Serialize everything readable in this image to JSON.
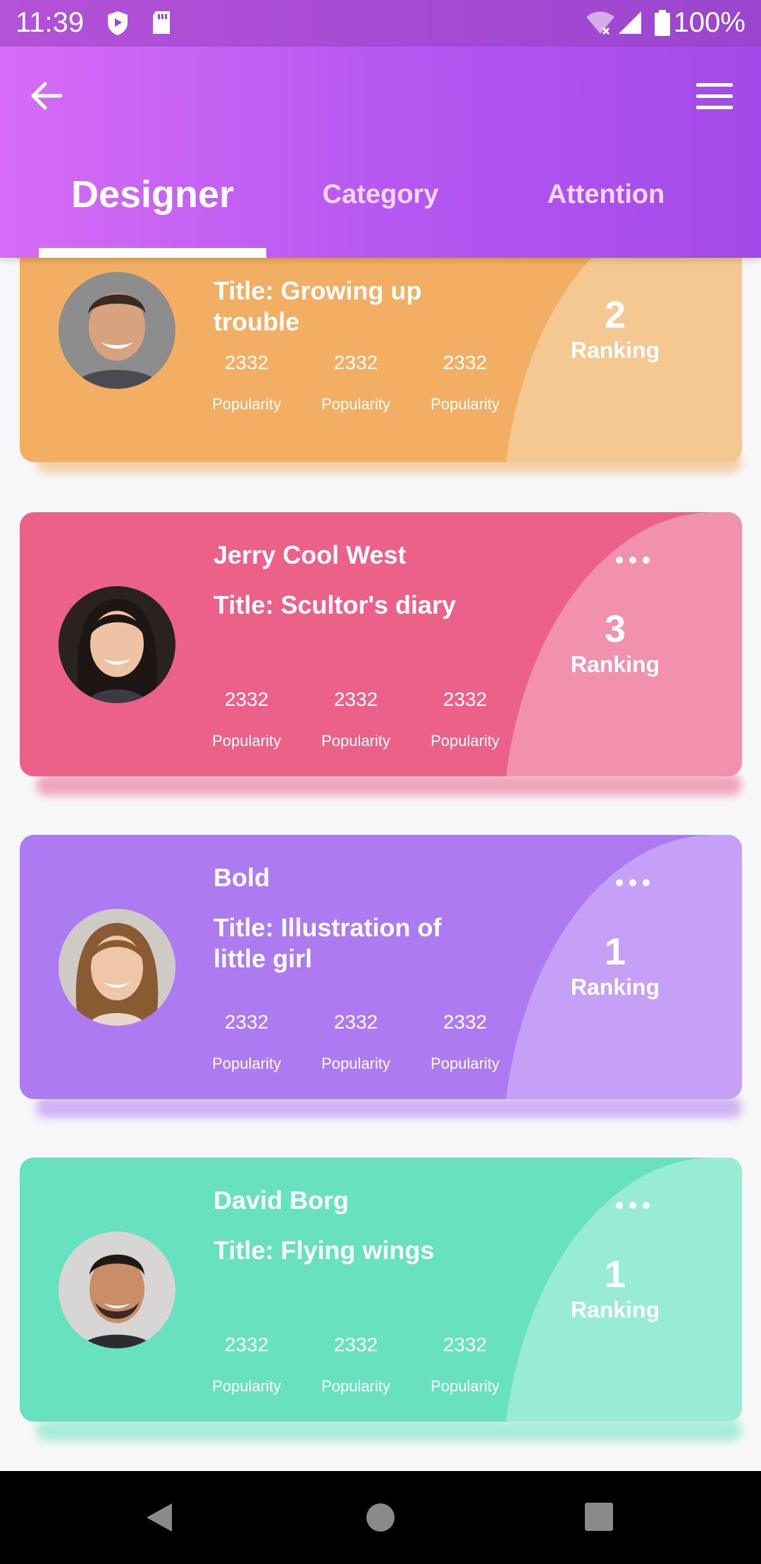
{
  "status": {
    "time": "11:39",
    "battery": "100%"
  },
  "header": {
    "tabs": [
      {
        "label": "Designer"
      },
      {
        "label": "Category"
      },
      {
        "label": "Attention"
      }
    ]
  },
  "cards": [
    {
      "name": "",
      "title": "Title: Growing up trouble",
      "rank": "2",
      "rank_label": "Ranking",
      "stats": [
        {
          "value": "2332",
          "label": "Popularity"
        },
        {
          "value": "2332",
          "label": "Popularity"
        },
        {
          "value": "2332",
          "label": "Popularity"
        }
      ],
      "color": "#f2ae63",
      "blob_color": "#f5c791"
    },
    {
      "name": "Jerry Cool West",
      "title": "Title: Scultor's diary",
      "rank": "3",
      "rank_label": "Ranking",
      "stats": [
        {
          "value": "2332",
          "label": "Popularity"
        },
        {
          "value": "2332",
          "label": "Popularity"
        },
        {
          "value": "2332",
          "label": "Popularity"
        }
      ],
      "color": "#ec6189",
      "blob_color": "#f191ae"
    },
    {
      "name": "Bold",
      "title": "Title: Illustration of little girl",
      "rank": "1",
      "rank_label": "Ranking",
      "stats": [
        {
          "value": "2332",
          "label": "Popularity"
        },
        {
          "value": "2332",
          "label": "Popularity"
        },
        {
          "value": "2332",
          "label": "Popularity"
        }
      ],
      "color": "#ad7af2",
      "blob_color": "#c6a0f6"
    },
    {
      "name": "David Borg",
      "title": "Title: Flying wings",
      "rank": "1",
      "rank_label": "Ranking",
      "stats": [
        {
          "value": "2332",
          "label": "Popularity"
        },
        {
          "value": "2332",
          "label": "Popularity"
        },
        {
          "value": "2332",
          "label": "Popularity"
        }
      ],
      "color": "#68e2be",
      "blob_color": "#98ecd3"
    }
  ],
  "icons": {
    "back": "arrow-left-icon",
    "menu": "hamburger-menu-icon",
    "more": "more-horizontal-icon"
  }
}
